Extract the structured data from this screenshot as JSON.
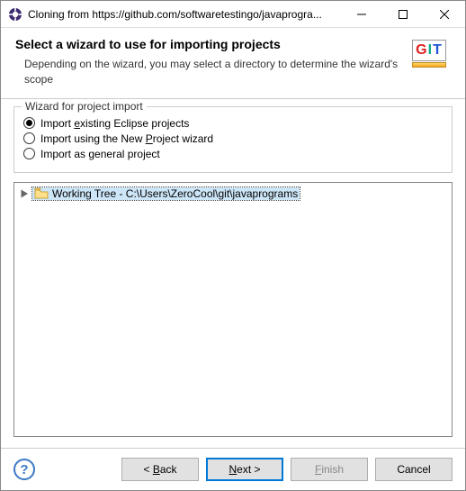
{
  "titlebar": {
    "title": "Cloning from https://github.com/softwaretestingo/javaprogra..."
  },
  "header": {
    "title": "Select a wizard to use for importing projects",
    "description": "Depending on the wizard, you may select a directory to determine the wizard's scope",
    "logo": {
      "g": "G",
      "i": "I",
      "t": "T"
    }
  },
  "wizard_group": {
    "title": "Wizard for project import",
    "options": [
      {
        "before": "Import ",
        "accel": "e",
        "after": "xisting Eclipse projects",
        "checked": true
      },
      {
        "before": "Import using the New ",
        "accel": "P",
        "after": "roject wizard",
        "checked": false
      },
      {
        "before": "Import as ",
        "accel": "g",
        "after": "eneral project",
        "checked": false
      }
    ]
  },
  "tree": {
    "items": [
      {
        "label": "Working Tree - C:\\Users\\ZeroCool\\git\\javaprograms",
        "selected": true
      }
    ]
  },
  "footer": {
    "help": "?",
    "back": {
      "lt": "< ",
      "accel": "B",
      "after": "ack"
    },
    "next": {
      "accel": "N",
      "after": "ext >"
    },
    "finish": {
      "before": "",
      "accel": "F",
      "after": "inish"
    },
    "cancel": "Cancel"
  }
}
